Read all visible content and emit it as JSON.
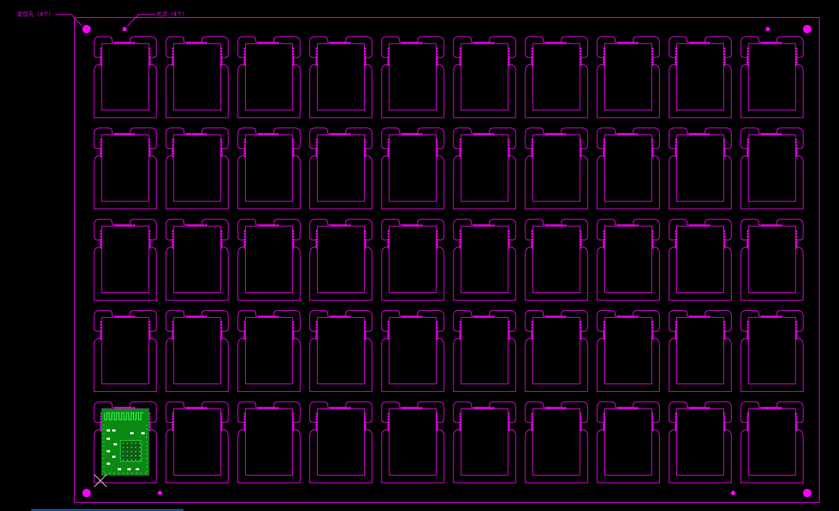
{
  "annotations": {
    "tooling_holes": "定位孔（4个）",
    "fiducials": "光点（4个）"
  },
  "panel": {
    "rows": 5,
    "columns": 10,
    "tooling_hole_count": 4,
    "fiducial_count": 4,
    "populated_board": {
      "row": 5,
      "column": 1
    }
  },
  "colors": {
    "background": "#000000",
    "outline": "#ff00ff",
    "copper": "#0a8a12",
    "copper_detail": "#2fe04a",
    "silk": "#ffffff"
  }
}
